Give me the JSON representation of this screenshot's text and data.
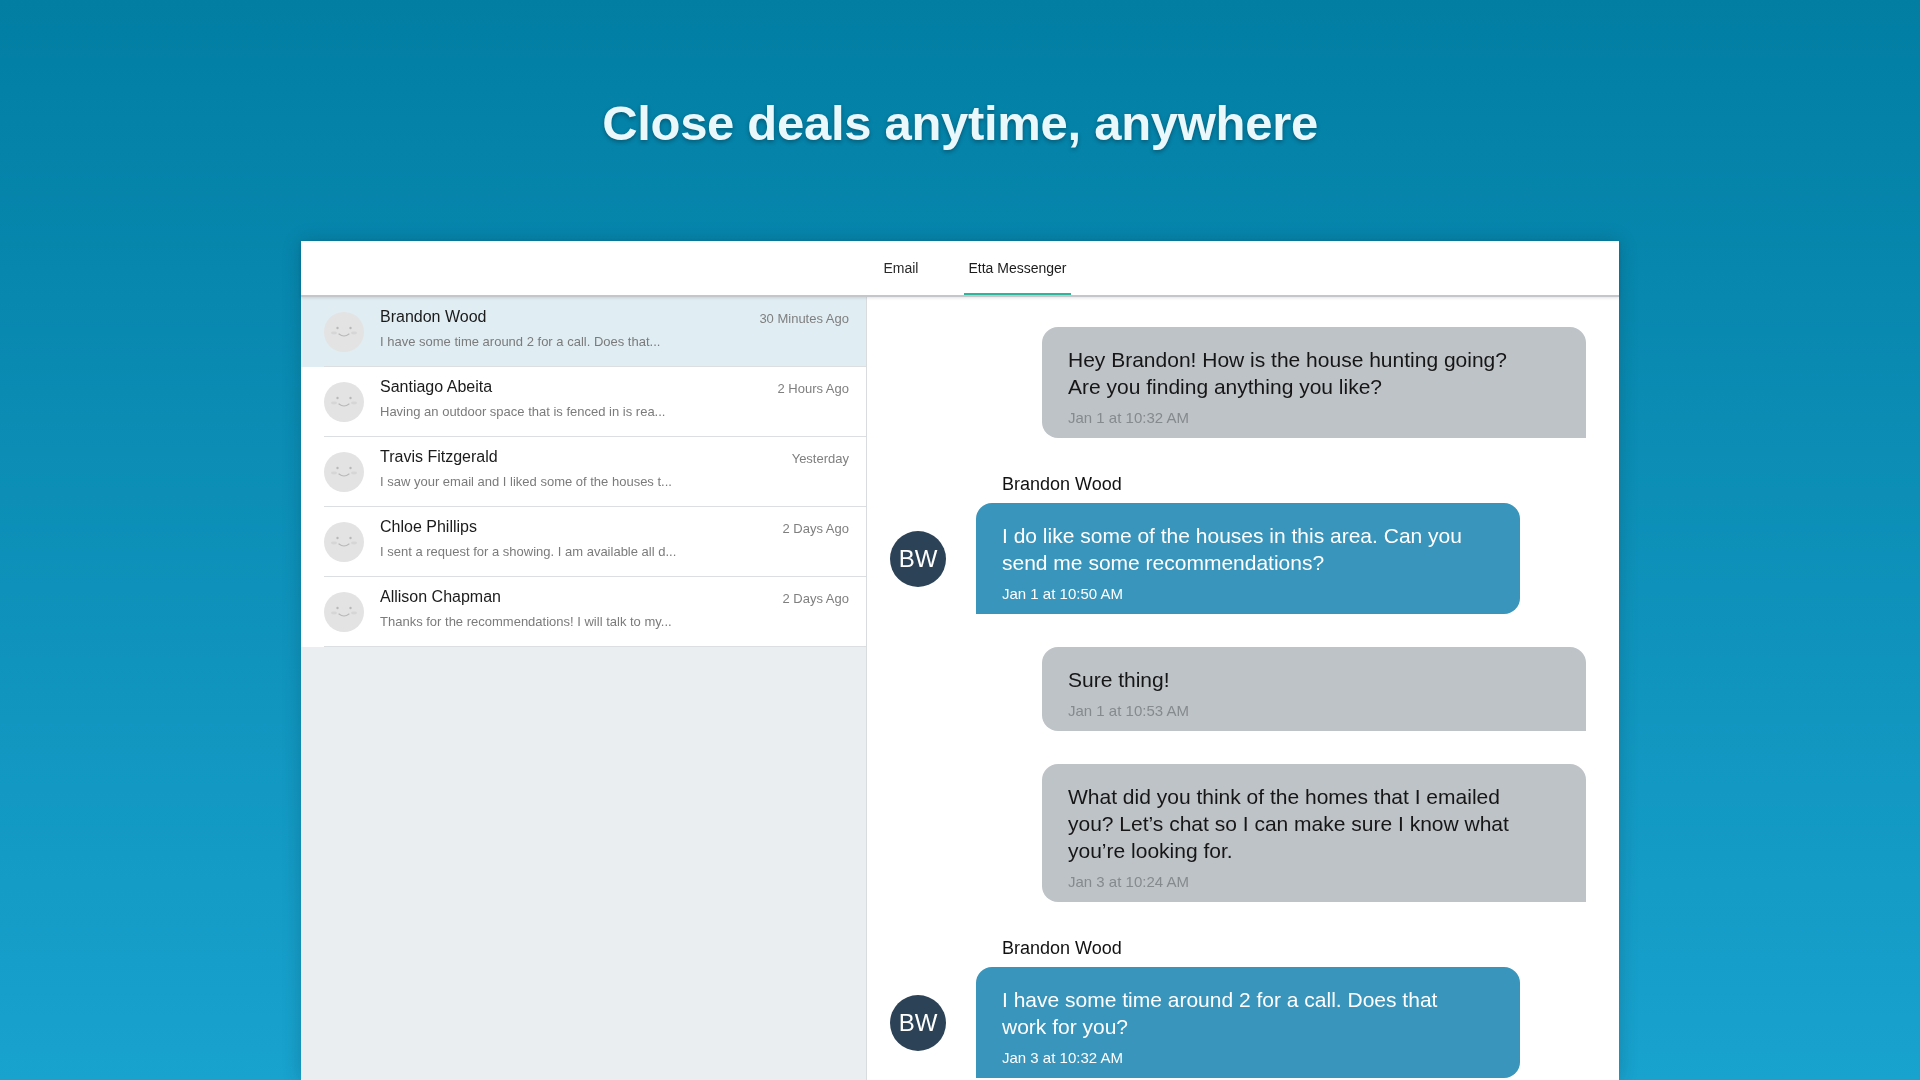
{
  "headline": "Close deals anytime, anywhere",
  "tabs": [
    {
      "label": "Email",
      "selected": false
    },
    {
      "label": "Etta Messenger",
      "selected": true
    }
  ],
  "conversations": [
    {
      "name": "Brandon Wood",
      "preview": "I have some time around 2 for a call. Does that...",
      "time": "30 Minutes Ago",
      "selected": true
    },
    {
      "name": "Santiago Abeita",
      "preview": "Having an outdoor space that is fenced in is rea...",
      "time": "2 Hours Ago",
      "selected": false
    },
    {
      "name": "Travis Fitzgerald",
      "preview": "I saw your email and I liked some of the houses t...",
      "time": "Yesterday",
      "selected": false
    },
    {
      "name": "Chloe Phillips",
      "preview": "I sent a request for a showing. I am available all d...",
      "time": "2 Days Ago",
      "selected": false
    },
    {
      "name": "Allison Chapman",
      "preview": "Thanks for the recommendations! I will talk to my...",
      "time": "2 Days Ago",
      "selected": false
    }
  ],
  "messages": [
    {
      "kind": "outgoing",
      "text": "Hey Brandon! How is the house hunting going? Are you finding anything you like?",
      "time": "Jan 1 at 10:32 AM"
    },
    {
      "kind": "incoming",
      "sender": "Brandon Wood",
      "initials": "BW",
      "text": "I do like some of the houses in this area. Can you send me some recommendations?",
      "time": "Jan 1 at 10:50 AM"
    },
    {
      "kind": "outgoing",
      "text": "Sure thing!",
      "time": "Jan 1 at 10:53 AM"
    },
    {
      "kind": "outgoing",
      "text": "What did you think of the homes that I emailed you? Let’s chat so I can make sure I know what you’re looking for.",
      "time": "Jan 3 at 10:24 AM"
    },
    {
      "kind": "incoming",
      "sender": "Brandon Wood",
      "initials": "BW",
      "text": "I have some time around 2 for a call. Does that work for you?",
      "time": "Jan 3 at 10:32 AM"
    }
  ]
}
